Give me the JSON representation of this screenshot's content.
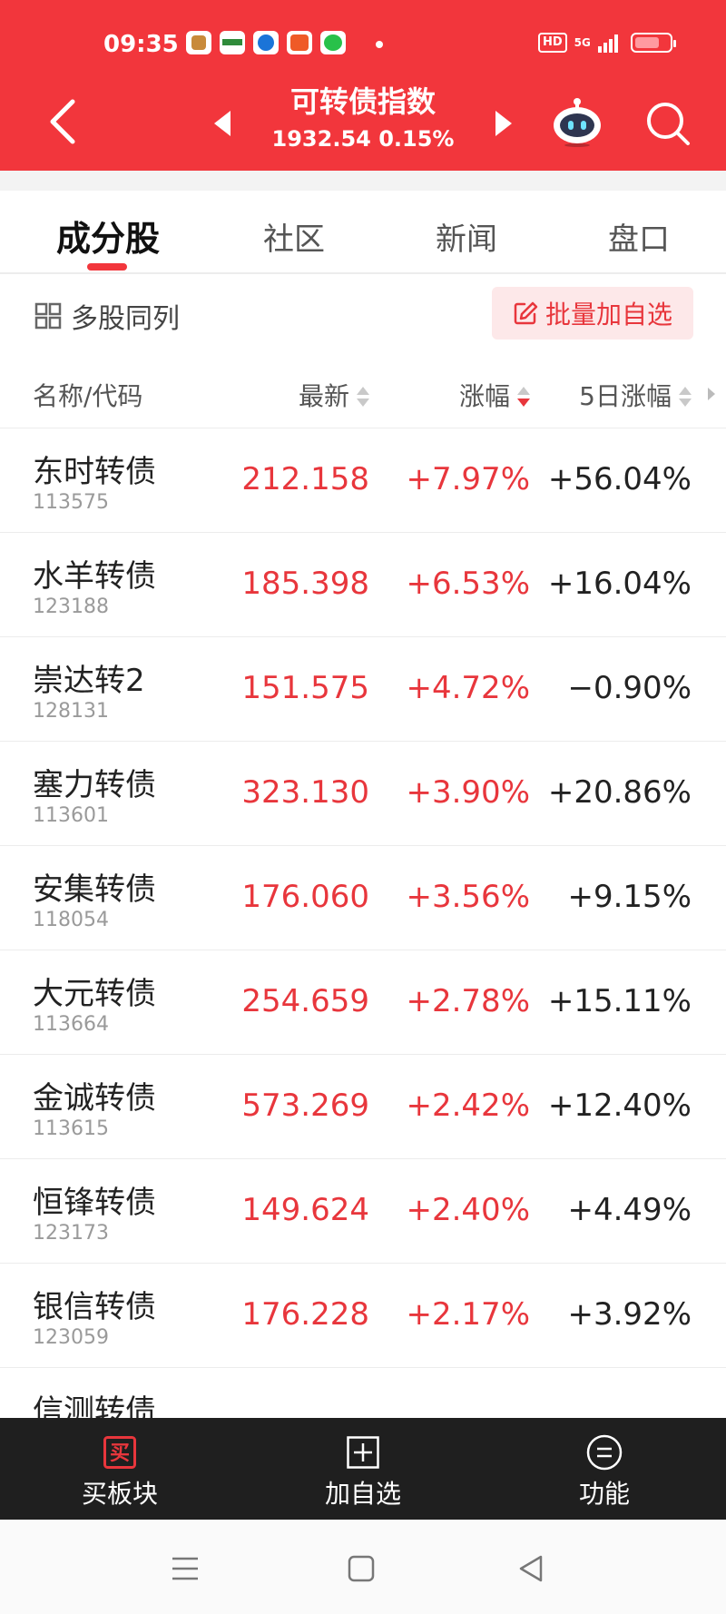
{
  "status_bar": {
    "time": "09:35",
    "hd": "HD",
    "network": "5G",
    "app_icons": [
      "app-icon-1",
      "app-icon-2",
      "app-icon-3",
      "app-icon-4",
      "app-icon-5"
    ]
  },
  "header": {
    "title": "可转债指数",
    "subtitle": "1932.54 0.15%",
    "background_color": "#f2363c"
  },
  "tabs": [
    {
      "label": "成分股",
      "active": true
    },
    {
      "label": "社区",
      "active": false
    },
    {
      "label": "新闻",
      "active": false
    },
    {
      "label": "盘口",
      "active": false
    }
  ],
  "toolbar": {
    "multi_view_label": "多股同列",
    "batch_add_label": "批量加自选"
  },
  "columns": {
    "name_code": "名称/代码",
    "latest": "最新",
    "change": "涨幅",
    "change_5d": "5日涨幅"
  },
  "rows": [
    {
      "name": "东时转债",
      "code": "113575",
      "price": "212.158",
      "change": "+7.97%",
      "change_5d": "+56.04%"
    },
    {
      "name": "水羊转债",
      "code": "123188",
      "price": "185.398",
      "change": "+6.53%",
      "change_5d": "+16.04%"
    },
    {
      "name": "崇达转2",
      "code": "128131",
      "price": "151.575",
      "change": "+4.72%",
      "change_5d": "−0.90%"
    },
    {
      "name": "塞力转债",
      "code": "113601",
      "price": "323.130",
      "change": "+3.90%",
      "change_5d": "+20.86%"
    },
    {
      "name": "安集转债",
      "code": "118054",
      "price": "176.060",
      "change": "+3.56%",
      "change_5d": "+9.15%"
    },
    {
      "name": "大元转债",
      "code": "113664",
      "price": "254.659",
      "change": "+2.78%",
      "change_5d": "+15.11%"
    },
    {
      "name": "金诚转债",
      "code": "113615",
      "price": "573.269",
      "change": "+2.42%",
      "change_5d": "+12.40%"
    },
    {
      "name": "恒锋转债",
      "code": "123173",
      "price": "149.624",
      "change": "+2.40%",
      "change_5d": "+4.49%"
    },
    {
      "name": "银信转债",
      "code": "123059",
      "price": "176.228",
      "change": "+2.17%",
      "change_5d": "+3.92%"
    },
    {
      "name": "信测转债",
      "code": "",
      "price": "",
      "change": "",
      "change_5d": ""
    }
  ],
  "bottom_bar": {
    "buy_icon_char": "买",
    "buy_sector": "买板块",
    "add_watchlist": "加自选",
    "functions": "功能"
  },
  "colors": {
    "up": "#e8363c",
    "accent": "#f2363c",
    "bottom_bar": "#1f1f1f"
  }
}
